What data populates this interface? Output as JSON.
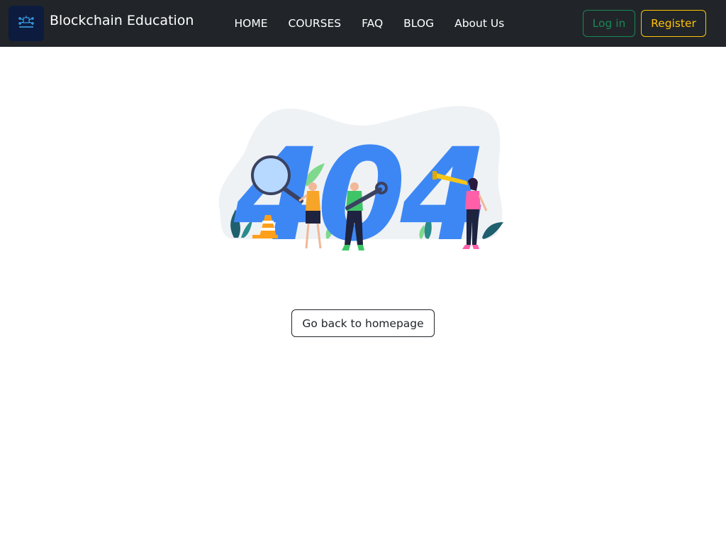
{
  "brand": {
    "name": "Blockchain Education",
    "logo": "blockchain-logo"
  },
  "nav": {
    "items": [
      {
        "label": "HOME"
      },
      {
        "label": "COURSES"
      },
      {
        "label": "FAQ"
      },
      {
        "label": "BLOG"
      },
      {
        "label": "About Us"
      }
    ]
  },
  "auth": {
    "login_label": "Log in",
    "register_label": "Register"
  },
  "error": {
    "code": "404",
    "home_button_label": "Go back to homepage"
  },
  "colors": {
    "navbar_bg": "#212529",
    "login": "#198754",
    "register": "#ffc107",
    "error_digits": "#3d87f5",
    "blob": "#eef2f5"
  }
}
